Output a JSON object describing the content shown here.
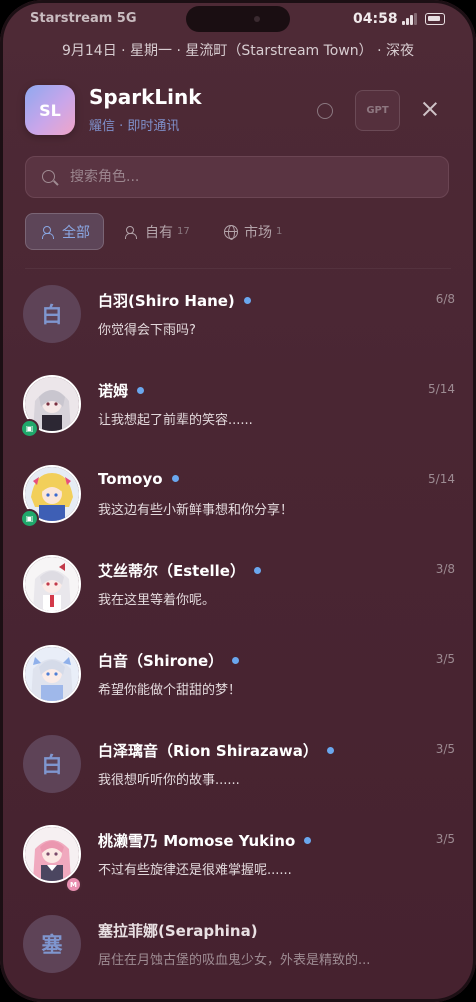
{
  "status": {
    "carrier": "Starstream 5G",
    "time": "04:58"
  },
  "dateline": "9月14日 · 星期一 · 星流町（Starstream Town） · 深夜",
  "header": {
    "logo": "SL",
    "title": "SparkLink",
    "subtitle": "耀信 · 即时通讯",
    "gpt_label": "GPT"
  },
  "search": {
    "placeholder": "搜索角色..."
  },
  "tabs": [
    {
      "label": "全部",
      "count": "",
      "icon": "users-icon"
    },
    {
      "label": "自有",
      "count": "17",
      "icon": "users-icon"
    },
    {
      "label": "市场",
      "count": "1",
      "icon": "globe-icon"
    }
  ],
  "contacts": [
    {
      "name": "白羽(Shiro Hane)",
      "avatar_letter": "白",
      "message": "你觉得会下雨吗?",
      "count": "6/8",
      "online": true
    },
    {
      "name": "诺姆",
      "avatar": "anime-girl-dark",
      "badge": "green",
      "message": "让我想起了前辈的笑容......",
      "count": "5/14",
      "online": true
    },
    {
      "name": "Tomoyo",
      "avatar": "anime-girl-blonde",
      "badge": "green",
      "message": "我这边有些小新鲜事想和你分享！",
      "count": "5/14",
      "online": true
    },
    {
      "name": "艾丝蒂尔（Estelle）",
      "avatar": "anime-girl-white",
      "message": "我在这里等着你呢。",
      "count": "3/8",
      "online": true
    },
    {
      "name": "白音（Shirone）",
      "avatar": "anime-girl-blue",
      "message": "希望你能做个甜甜的梦！",
      "count": "3/5",
      "online": true
    },
    {
      "name": "白泽璃音（Rion Shirazawa）",
      "avatar_letter": "白",
      "message": "我很想听听你的故事......",
      "count": "3/5",
      "online": true
    },
    {
      "name": "桃濑雪乃 Momose Yukino",
      "avatar": "anime-girl-pink",
      "badge": "pink",
      "badge_text": "M",
      "message": "不过有些旋律还是很难掌握呢......",
      "count": "3/5",
      "online": true
    },
    {
      "name": "塞拉菲娜(Seraphina)",
      "avatar_letter": "塞",
      "message": "居住在月蚀古堡的吸血鬼少女，外表是精致的...",
      "count": "",
      "online": false
    }
  ],
  "colors": {
    "accent": "#6aa7ee",
    "badge_green": "#1fa86b",
    "background": "#4a2633"
  }
}
